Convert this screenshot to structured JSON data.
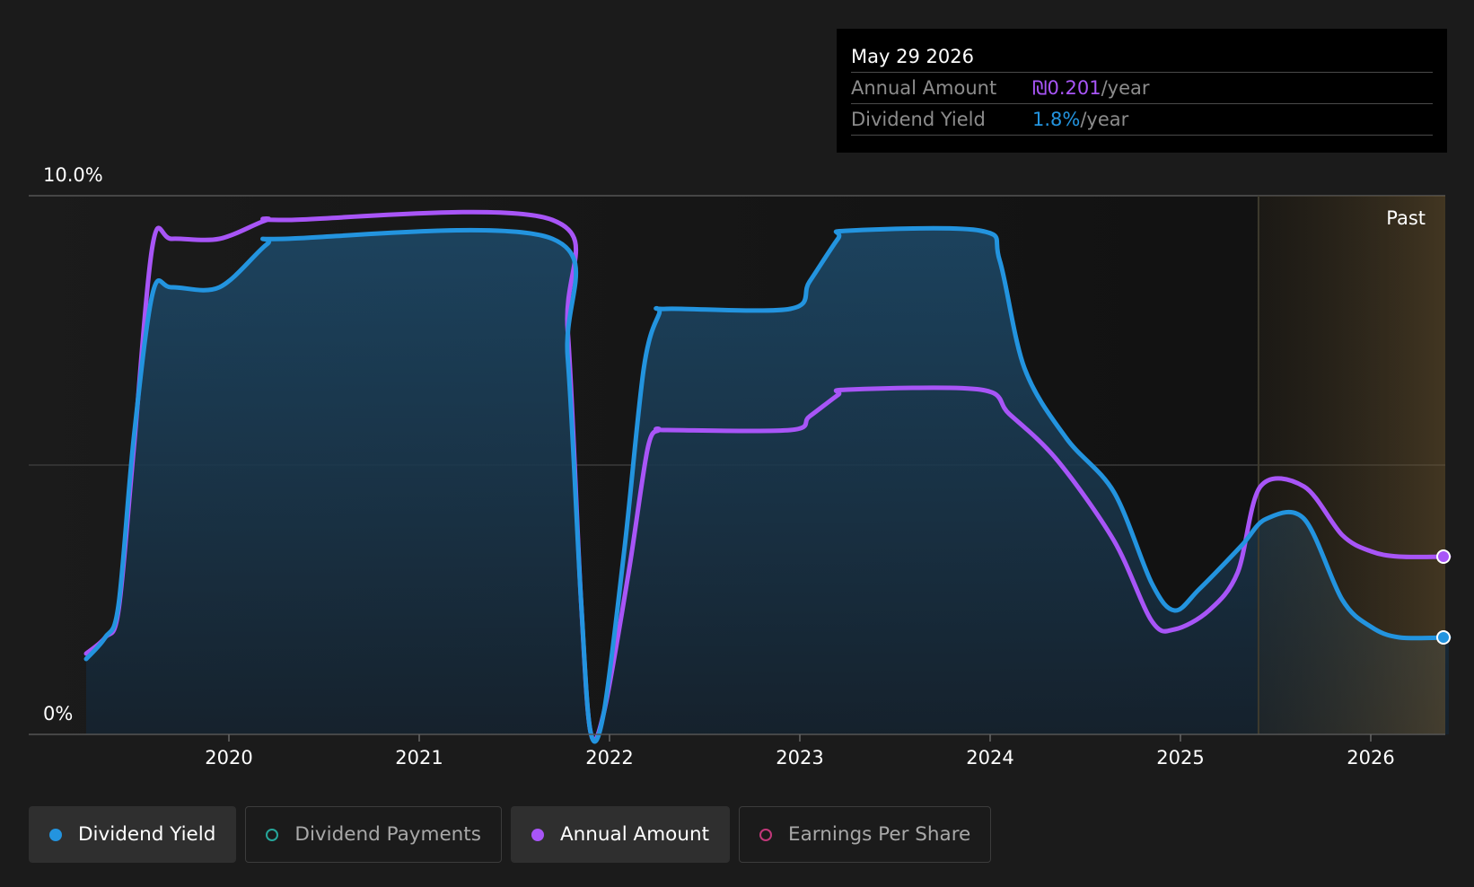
{
  "tooltip": {
    "date": "May 29 2026",
    "annual_label": "Annual Amount",
    "annual_value": "₪0.201",
    "annual_unit": "/year",
    "yield_label": "Dividend Yield",
    "yield_value": "1.8%",
    "yield_unit": "/year"
  },
  "legend": [
    {
      "label": "Dividend Yield",
      "color": "#2394df",
      "active": true,
      "filled": true
    },
    {
      "label": "Dividend Payments",
      "color": "#26a69a",
      "active": false,
      "filled": false
    },
    {
      "label": "Annual Amount",
      "color": "#a855f7",
      "active": true,
      "filled": true
    },
    {
      "label": "Earnings Per Share",
      "color": "#c2387a",
      "active": false,
      "filled": false
    }
  ],
  "chart_data": {
    "type": "line",
    "ylim": [
      0,
      10
    ],
    "y_tick_labels": [
      "10.0%",
      "0%"
    ],
    "x_ticks": [
      "2020",
      "2021",
      "2022",
      "2023",
      "2024",
      "2025",
      "2026"
    ],
    "past_label": "Past",
    "past_start": 2025.41,
    "x_range": [
      2019.25,
      2026.41
    ],
    "grid": true,
    "series": [
      {
        "name": "Dividend Yield",
        "color": "#2394df",
        "points": [
          [
            2019.25,
            1.4
          ],
          [
            2019.35,
            1.8
          ],
          [
            2019.42,
            2.4
          ],
          [
            2019.5,
            5.5
          ],
          [
            2019.6,
            8.2
          ],
          [
            2019.7,
            8.3
          ],
          [
            2019.95,
            8.3
          ],
          [
            2020.2,
            9.1
          ],
          [
            2020.3,
            9.2
          ],
          [
            2021.7,
            9.2
          ],
          [
            2021.78,
            7.0
          ],
          [
            2021.85,
            2.5
          ],
          [
            2021.9,
            0.05
          ],
          [
            2021.97,
            0.4
          ],
          [
            2022.08,
            3.5
          ],
          [
            2022.18,
            6.8
          ],
          [
            2022.26,
            7.8
          ],
          [
            2022.3,
            7.9
          ],
          [
            2022.95,
            7.9
          ],
          [
            2023.05,
            8.4
          ],
          [
            2023.2,
            9.2
          ],
          [
            2023.25,
            9.35
          ],
          [
            2023.95,
            9.35
          ],
          [
            2024.05,
            8.8
          ],
          [
            2024.18,
            6.8
          ],
          [
            2024.4,
            5.5
          ],
          [
            2024.65,
            4.5
          ],
          [
            2024.85,
            2.8
          ],
          [
            2024.97,
            2.3
          ],
          [
            2025.1,
            2.7
          ],
          [
            2025.32,
            3.5
          ],
          [
            2025.45,
            4.0
          ],
          [
            2025.65,
            4.0
          ],
          [
            2025.85,
            2.5
          ],
          [
            2026.0,
            2.0
          ],
          [
            2026.15,
            1.8
          ],
          [
            2026.41,
            1.8
          ]
        ]
      },
      {
        "name": "Annual Amount",
        "color": "#a855f7",
        "points": [
          [
            2019.25,
            1.5
          ],
          [
            2019.35,
            1.8
          ],
          [
            2019.42,
            2.3
          ],
          [
            2019.5,
            5.3
          ],
          [
            2019.6,
            9.1
          ],
          [
            2019.7,
            9.2
          ],
          [
            2019.95,
            9.2
          ],
          [
            2020.2,
            9.55
          ],
          [
            2020.3,
            9.55
          ],
          [
            2021.7,
            9.55
          ],
          [
            2021.78,
            7.5
          ],
          [
            2021.85,
            2.5
          ],
          [
            2021.9,
            0.05
          ],
          [
            2021.97,
            0.4
          ],
          [
            2022.1,
            3.0
          ],
          [
            2022.2,
            5.3
          ],
          [
            2022.26,
            5.65
          ],
          [
            2022.3,
            5.65
          ],
          [
            2022.95,
            5.65
          ],
          [
            2023.05,
            5.9
          ],
          [
            2023.2,
            6.3
          ],
          [
            2023.25,
            6.4
          ],
          [
            2023.95,
            6.4
          ],
          [
            2024.1,
            5.95
          ],
          [
            2024.35,
            5.1
          ],
          [
            2024.65,
            3.6
          ],
          [
            2024.85,
            2.1
          ],
          [
            2024.97,
            1.95
          ],
          [
            2025.15,
            2.3
          ],
          [
            2025.3,
            3.0
          ],
          [
            2025.42,
            4.6
          ],
          [
            2025.65,
            4.6
          ],
          [
            2025.85,
            3.7
          ],
          [
            2026.0,
            3.4
          ],
          [
            2026.15,
            3.3
          ],
          [
            2026.41,
            3.3
          ]
        ]
      }
    ]
  }
}
